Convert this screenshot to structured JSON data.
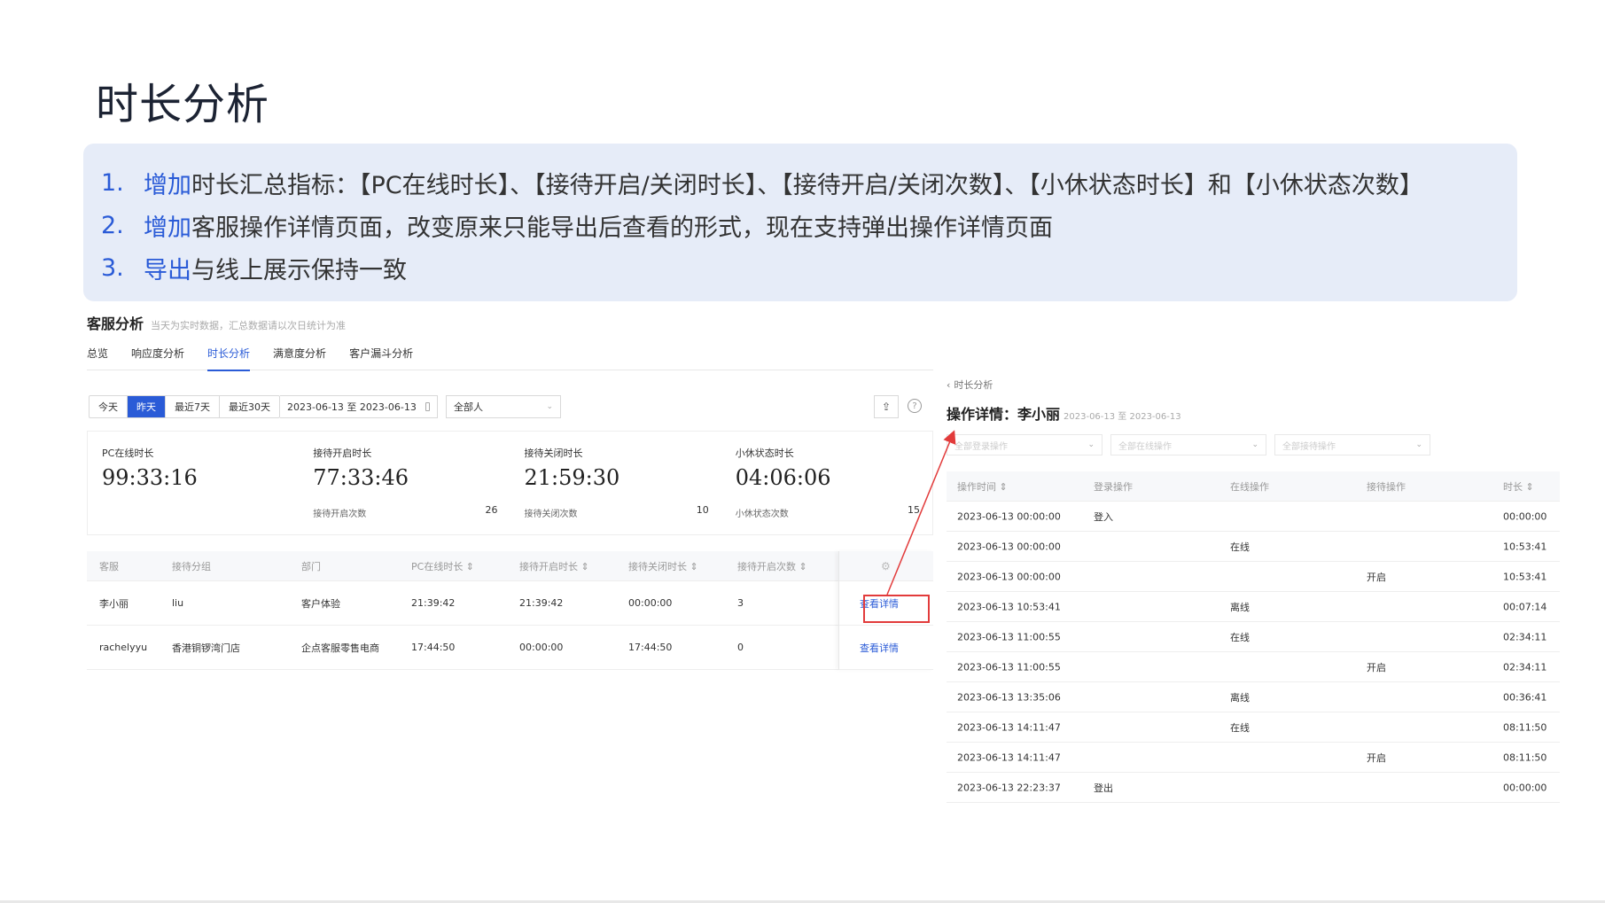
{
  "slide": {
    "title": "时长分析",
    "notes": [
      {
        "num": "1.",
        "key": "增加",
        "text": "时长汇总指标：【PC在线时长】、【接待开启/关闭时长】、【接待开启/关闭次数】、【小休状态时长】和【小休状态次数】"
      },
      {
        "num": "2.",
        "key": "增加",
        "text": "客服操作详情页面，改变原来只能导出后查看的形式，现在支持弹出操作详情页面"
      },
      {
        "num": "3.",
        "key": "导出",
        "text": "与线上展示保持一致"
      }
    ]
  },
  "left": {
    "title": "客服分析",
    "subtitle": "当天为实时数据，汇总数据请以次日统计为准",
    "tabs": [
      "总览",
      "响应度分析",
      "时长分析",
      "满意度分析",
      "客户漏斗分析"
    ],
    "active_tab": 2,
    "date_buttons": [
      "今天",
      "昨天",
      "最近7天",
      "最近30天"
    ],
    "active_date": 1,
    "date_range": "2023-06-13 至 2023-06-13",
    "person_select": "全部人",
    "stats": [
      {
        "label": "PC在线时长",
        "value": "99:33:16",
        "sub": "",
        "count": ""
      },
      {
        "label": "接待开启时长",
        "value": "77:33:46",
        "sub": "接待开启次数",
        "count": "26"
      },
      {
        "label": "接待关闭时长",
        "value": "21:59:30",
        "sub": "接待关闭次数",
        "count": "10"
      },
      {
        "label": "小休状态时长",
        "value": "04:06:06",
        "sub": "小休状态次数",
        "count": "15"
      }
    ],
    "table": {
      "headers": [
        "客服",
        "接待分组",
        "部门",
        "PC在线时长 ⇕",
        "接待开启时长 ⇕",
        "接待关闭时长 ⇕",
        "接待开启次数 ⇕"
      ],
      "rows": [
        [
          "李小丽",
          "liu",
          "客户体验",
          "21:39:42",
          "21:39:42",
          "00:00:00",
          "3"
        ],
        [
          "rachelyyu",
          "香港铜锣湾门店",
          "企点客服零售电商",
          "17:44:50",
          "00:00:00",
          "17:44:50",
          "0"
        ]
      ],
      "action_label": "查看详情"
    }
  },
  "right": {
    "back_label": "时长分析",
    "title": "操作详情：李小丽",
    "date": "2023-06-13 至 2023-06-13",
    "filters": [
      "全部登录操作",
      "全部在线操作",
      "全部接待操作"
    ],
    "headers": [
      "操作时间 ⇕",
      "登录操作",
      "在线操作",
      "接待操作",
      "时长 ⇕"
    ],
    "rows": [
      [
        "2023-06-13 00:00:00",
        "登入",
        "",
        "",
        "00:00:00"
      ],
      [
        "2023-06-13 00:00:00",
        "",
        "在线",
        "",
        "10:53:41"
      ],
      [
        "2023-06-13 00:00:00",
        "",
        "",
        "开启",
        "10:53:41"
      ],
      [
        "2023-06-13 10:53:41",
        "",
        "离线",
        "",
        "00:07:14"
      ],
      [
        "2023-06-13 11:00:55",
        "",
        "在线",
        "",
        "02:34:11"
      ],
      [
        "2023-06-13 11:00:55",
        "",
        "",
        "开启",
        "02:34:11"
      ],
      [
        "2023-06-13 13:35:06",
        "",
        "离线",
        "",
        "00:36:41"
      ],
      [
        "2023-06-13 14:11:47",
        "",
        "在线",
        "",
        "08:11:50"
      ],
      [
        "2023-06-13 14:11:47",
        "",
        "",
        "开启",
        "08:11:50"
      ],
      [
        "2023-06-13 22:23:37",
        "登出",
        "",
        "",
        "00:00:00"
      ]
    ]
  },
  "colors": {
    "accent": "#2a5bd7",
    "highlight": "#e23b3b",
    "panel_bg": "#e6ecf8"
  }
}
